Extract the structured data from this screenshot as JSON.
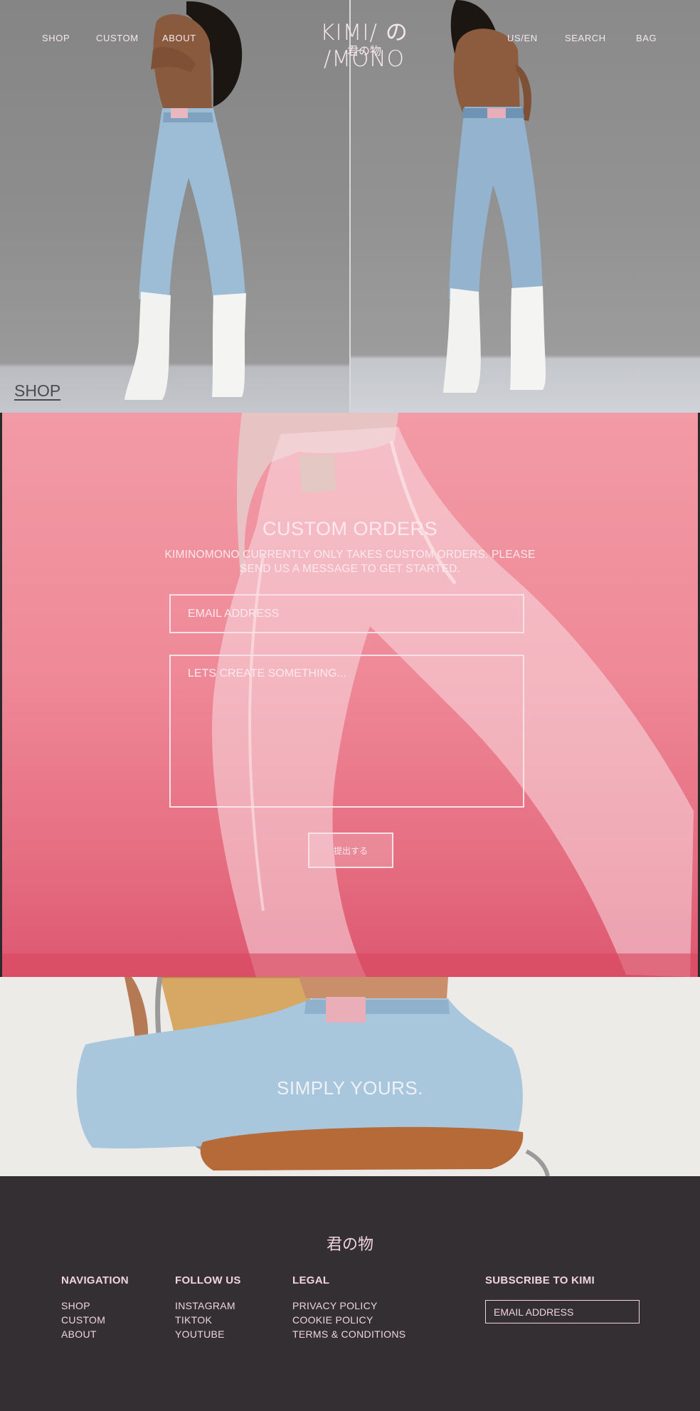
{
  "brand": {
    "logo": "KIMI/ の /MONO",
    "logo_sub": "君の物"
  },
  "nav": {
    "left": [
      "SHOP",
      "CUSTOM",
      "ABOUT"
    ],
    "right": [
      "US/EN",
      "SEARCH",
      "BAG"
    ]
  },
  "hero": {
    "shop_link": "SHOP"
  },
  "custom_orders": {
    "title": "CUSTOM ORDERS",
    "description": "KIMINOMONO CURRENTLY ONLY TAKES CUSTOM ORDERS. PLEASE SEND US A MESSAGE TO GET STARTED.",
    "email_placeholder": "EMAIL ADDRESS",
    "message_placeholder": "LETS CREATE SOMETHING...",
    "submit_label": "提出する"
  },
  "tagline": {
    "text": "SIMPLY YOURS."
  },
  "footer": {
    "brand": "君の物",
    "columns": [
      {
        "heading": "NAVIGATION",
        "links": [
          "SHOP",
          "CUSTOM",
          "ABOUT"
        ]
      },
      {
        "heading": "FOLLOW US",
        "links": [
          "INSTAGRAM",
          "TIKTOK",
          "YOUTUBE"
        ]
      },
      {
        "heading": "LEGAL",
        "links": [
          "PRIVACY POLICY",
          "COOKIE POLICY",
          "TERMS & CONDITIONS"
        ]
      }
    ],
    "subscribe": {
      "heading": "SUBSCRIBE TO KIMI",
      "email_placeholder": "EMAIL ADDRESS"
    }
  },
  "colors": {
    "accent_pink": "#ef8a98",
    "footer_bg": "#332f33",
    "footer_text": "#f0d5dc"
  }
}
